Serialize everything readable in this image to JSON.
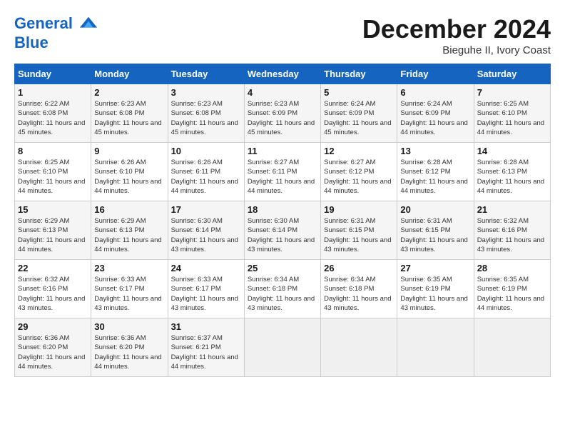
{
  "logo": {
    "line1": "General",
    "line2": "Blue"
  },
  "title": "December 2024",
  "subtitle": "Bieguhe II, Ivory Coast",
  "weekdays": [
    "Sunday",
    "Monday",
    "Tuesday",
    "Wednesday",
    "Thursday",
    "Friday",
    "Saturday"
  ],
  "weeks": [
    [
      {
        "day": "1",
        "sunrise": "Sunrise: 6:22 AM",
        "sunset": "Sunset: 6:08 PM",
        "daylight": "Daylight: 11 hours and 45 minutes."
      },
      {
        "day": "2",
        "sunrise": "Sunrise: 6:23 AM",
        "sunset": "Sunset: 6:08 PM",
        "daylight": "Daylight: 11 hours and 45 minutes."
      },
      {
        "day": "3",
        "sunrise": "Sunrise: 6:23 AM",
        "sunset": "Sunset: 6:08 PM",
        "daylight": "Daylight: 11 hours and 45 minutes."
      },
      {
        "day": "4",
        "sunrise": "Sunrise: 6:23 AM",
        "sunset": "Sunset: 6:09 PM",
        "daylight": "Daylight: 11 hours and 45 minutes."
      },
      {
        "day": "5",
        "sunrise": "Sunrise: 6:24 AM",
        "sunset": "Sunset: 6:09 PM",
        "daylight": "Daylight: 11 hours and 45 minutes."
      },
      {
        "day": "6",
        "sunrise": "Sunrise: 6:24 AM",
        "sunset": "Sunset: 6:09 PM",
        "daylight": "Daylight: 11 hours and 44 minutes."
      },
      {
        "day": "7",
        "sunrise": "Sunrise: 6:25 AM",
        "sunset": "Sunset: 6:10 PM",
        "daylight": "Daylight: 11 hours and 44 minutes."
      }
    ],
    [
      {
        "day": "8",
        "sunrise": "Sunrise: 6:25 AM",
        "sunset": "Sunset: 6:10 PM",
        "daylight": "Daylight: 11 hours and 44 minutes."
      },
      {
        "day": "9",
        "sunrise": "Sunrise: 6:26 AM",
        "sunset": "Sunset: 6:10 PM",
        "daylight": "Daylight: 11 hours and 44 minutes."
      },
      {
        "day": "10",
        "sunrise": "Sunrise: 6:26 AM",
        "sunset": "Sunset: 6:11 PM",
        "daylight": "Daylight: 11 hours and 44 minutes."
      },
      {
        "day": "11",
        "sunrise": "Sunrise: 6:27 AM",
        "sunset": "Sunset: 6:11 PM",
        "daylight": "Daylight: 11 hours and 44 minutes."
      },
      {
        "day": "12",
        "sunrise": "Sunrise: 6:27 AM",
        "sunset": "Sunset: 6:12 PM",
        "daylight": "Daylight: 11 hours and 44 minutes."
      },
      {
        "day": "13",
        "sunrise": "Sunrise: 6:28 AM",
        "sunset": "Sunset: 6:12 PM",
        "daylight": "Daylight: 11 hours and 44 minutes."
      },
      {
        "day": "14",
        "sunrise": "Sunrise: 6:28 AM",
        "sunset": "Sunset: 6:13 PM",
        "daylight": "Daylight: 11 hours and 44 minutes."
      }
    ],
    [
      {
        "day": "15",
        "sunrise": "Sunrise: 6:29 AM",
        "sunset": "Sunset: 6:13 PM",
        "daylight": "Daylight: 11 hours and 44 minutes."
      },
      {
        "day": "16",
        "sunrise": "Sunrise: 6:29 AM",
        "sunset": "Sunset: 6:13 PM",
        "daylight": "Daylight: 11 hours and 44 minutes."
      },
      {
        "day": "17",
        "sunrise": "Sunrise: 6:30 AM",
        "sunset": "Sunset: 6:14 PM",
        "daylight": "Daylight: 11 hours and 43 minutes."
      },
      {
        "day": "18",
        "sunrise": "Sunrise: 6:30 AM",
        "sunset": "Sunset: 6:14 PM",
        "daylight": "Daylight: 11 hours and 43 minutes."
      },
      {
        "day": "19",
        "sunrise": "Sunrise: 6:31 AM",
        "sunset": "Sunset: 6:15 PM",
        "daylight": "Daylight: 11 hours and 43 minutes."
      },
      {
        "day": "20",
        "sunrise": "Sunrise: 6:31 AM",
        "sunset": "Sunset: 6:15 PM",
        "daylight": "Daylight: 11 hours and 43 minutes."
      },
      {
        "day": "21",
        "sunrise": "Sunrise: 6:32 AM",
        "sunset": "Sunset: 6:16 PM",
        "daylight": "Daylight: 11 hours and 43 minutes."
      }
    ],
    [
      {
        "day": "22",
        "sunrise": "Sunrise: 6:32 AM",
        "sunset": "Sunset: 6:16 PM",
        "daylight": "Daylight: 11 hours and 43 minutes."
      },
      {
        "day": "23",
        "sunrise": "Sunrise: 6:33 AM",
        "sunset": "Sunset: 6:17 PM",
        "daylight": "Daylight: 11 hours and 43 minutes."
      },
      {
        "day": "24",
        "sunrise": "Sunrise: 6:33 AM",
        "sunset": "Sunset: 6:17 PM",
        "daylight": "Daylight: 11 hours and 43 minutes."
      },
      {
        "day": "25",
        "sunrise": "Sunrise: 6:34 AM",
        "sunset": "Sunset: 6:18 PM",
        "daylight": "Daylight: 11 hours and 43 minutes."
      },
      {
        "day": "26",
        "sunrise": "Sunrise: 6:34 AM",
        "sunset": "Sunset: 6:18 PM",
        "daylight": "Daylight: 11 hours and 43 minutes."
      },
      {
        "day": "27",
        "sunrise": "Sunrise: 6:35 AM",
        "sunset": "Sunset: 6:19 PM",
        "daylight": "Daylight: 11 hours and 43 minutes."
      },
      {
        "day": "28",
        "sunrise": "Sunrise: 6:35 AM",
        "sunset": "Sunset: 6:19 PM",
        "daylight": "Daylight: 11 hours and 44 minutes."
      }
    ],
    [
      {
        "day": "29",
        "sunrise": "Sunrise: 6:36 AM",
        "sunset": "Sunset: 6:20 PM",
        "daylight": "Daylight: 11 hours and 44 minutes."
      },
      {
        "day": "30",
        "sunrise": "Sunrise: 6:36 AM",
        "sunset": "Sunset: 6:20 PM",
        "daylight": "Daylight: 11 hours and 44 minutes."
      },
      {
        "day": "31",
        "sunrise": "Sunrise: 6:37 AM",
        "sunset": "Sunset: 6:21 PM",
        "daylight": "Daylight: 11 hours and 44 minutes."
      },
      null,
      null,
      null,
      null
    ]
  ]
}
